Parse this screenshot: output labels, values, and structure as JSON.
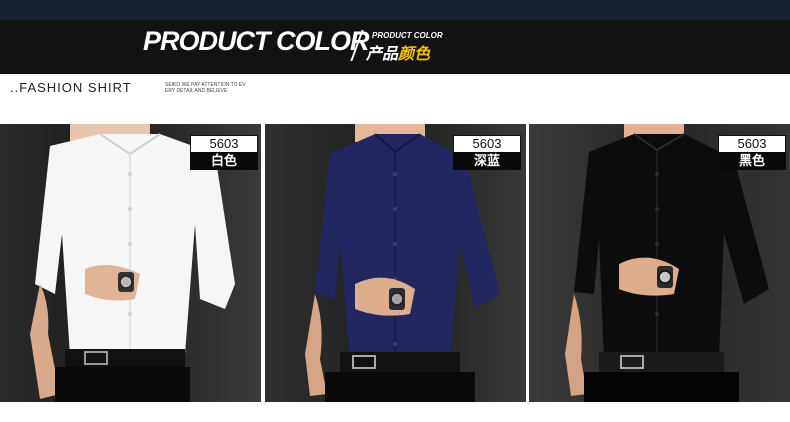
{
  "banner": {
    "title": "PRODUCT COLOR",
    "subtitle_en": "PRODUCT COLOR",
    "subtitle_cn_part1": "产品",
    "subtitle_cn_part2": "颜色",
    "accent_color": "#f2c200"
  },
  "section": {
    "heading": "..FASHION SHIRT",
    "tagline_line1": "SEIKO WE PAY ATTENTION TO EV",
    "tagline_line2": "ERY DETAIL AND BELIEVE"
  },
  "products": [
    {
      "code": "5603",
      "color_name": "白色",
      "shirt_color": "#ffffff"
    },
    {
      "code": "5603",
      "color_name": "深蓝",
      "shirt_color": "#1f2159"
    },
    {
      "code": "5603",
      "color_name": "黑色",
      "shirt_color": "#0d0d0d"
    }
  ]
}
